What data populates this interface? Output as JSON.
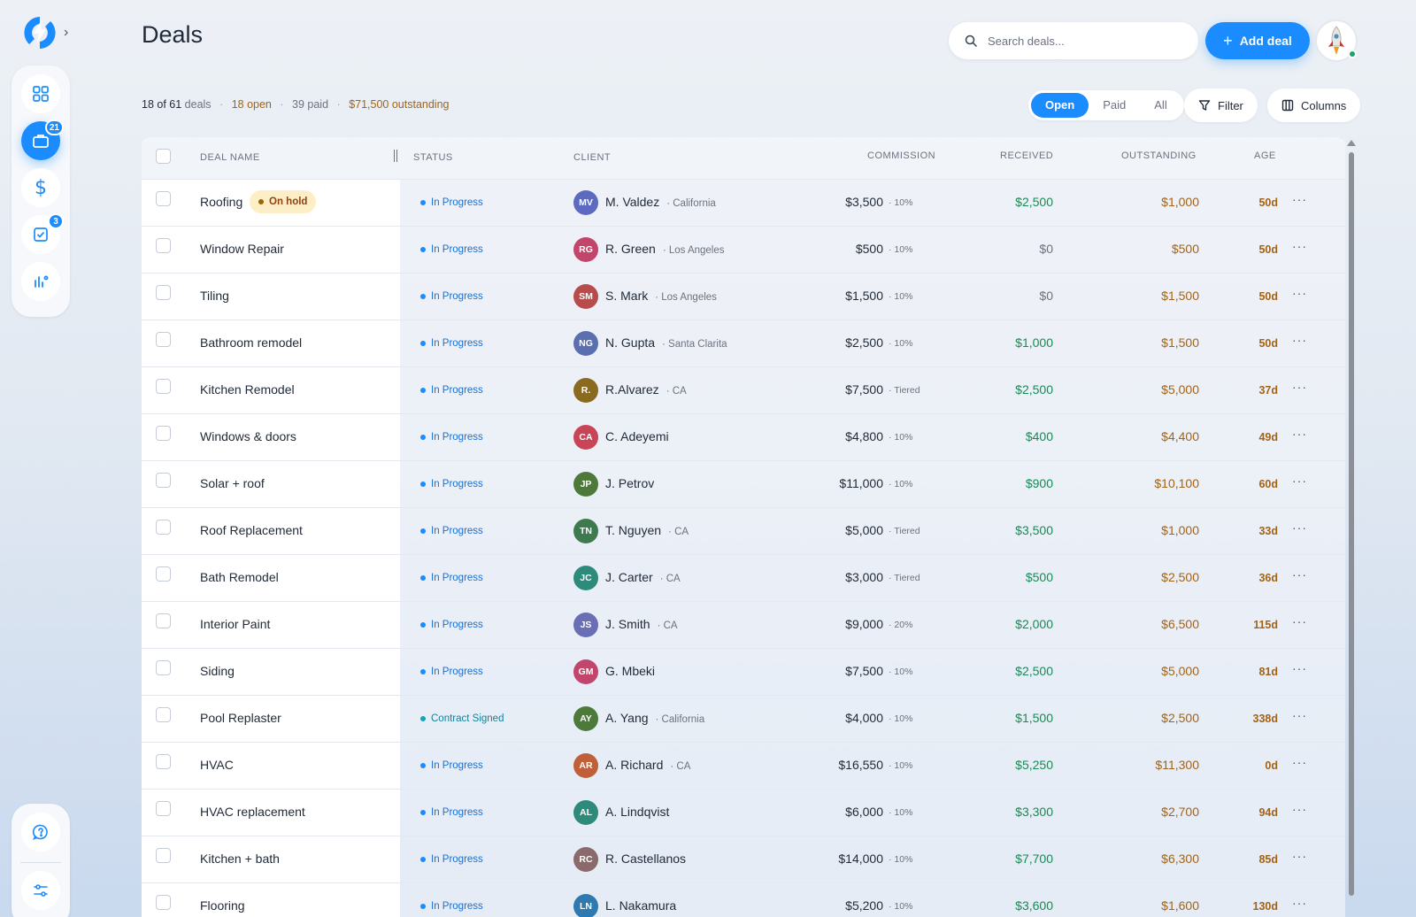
{
  "app": {
    "logo": "swap-logo-icon"
  },
  "header": {
    "title": "Deals",
    "search_placeholder": "Search deals...",
    "add_label": "Add deal"
  },
  "sidebar": {
    "items": [
      {
        "icon": "grid-icon",
        "badge": ""
      },
      {
        "icon": "briefcase-icon",
        "badge": "21"
      },
      {
        "icon": "dollar-icon",
        "badge": ""
      },
      {
        "icon": "checklist-icon",
        "badge": "3"
      },
      {
        "icon": "chart-icon",
        "badge": ""
      }
    ],
    "bottom": [
      {
        "icon": "help-chat-icon"
      },
      {
        "icon": "settings-sliders-icon"
      }
    ]
  },
  "summary": {
    "count": "18 of 61",
    "count_suffix": "deals",
    "open": "18 open",
    "paid": "39 paid",
    "outstanding": "$71,500 outstanding"
  },
  "filters": {
    "tabs": [
      "Open",
      "Paid",
      "All"
    ],
    "active": "Open",
    "filter_label": "Filter",
    "columns_label": "Columns"
  },
  "colors": {
    "accent": "#1a8cff",
    "received": "#178a55",
    "outstanding": "#a26316",
    "on_hold_bg": "#fcefc7"
  },
  "table": {
    "headers": {
      "deal_name": "DEAL NAME",
      "status": "STATUS",
      "client": "CLIENT",
      "commission": "COMMISSION",
      "received": "RECEIVED",
      "outstanding": "OUTSTANDING",
      "age": "AGE"
    },
    "rows": [
      {
        "name": "Roofing",
        "badge": "On hold",
        "status": "In Progress",
        "initials": "MV",
        "avatar": "#5c6bc0",
        "client": "M. Valdez",
        "loc": "· California",
        "commission": "$3,500",
        "rate": "· 10%",
        "received": "$2,500",
        "outstanding": "$1,000",
        "age": "50d"
      },
      {
        "name": "Window Repair",
        "badge": "",
        "status": "In Progress",
        "initials": "RG",
        "avatar": "#c2456b",
        "client": "R. Green",
        "loc": "· Los Angeles",
        "commission": "$500",
        "rate": "· 10%",
        "received": "$0",
        "outstanding": "$500",
        "age": "50d"
      },
      {
        "name": "Tiling",
        "badge": "",
        "status": "In Progress",
        "initials": "SM",
        "avatar": "#b84b4b",
        "client": "S. Mark",
        "loc": "· Los Angeles",
        "commission": "$1,500",
        "rate": "· 10%",
        "received": "$0",
        "outstanding": "$1,500",
        "age": "50d"
      },
      {
        "name": "Bathroom remodel",
        "badge": "",
        "status": "In Progress",
        "initials": "NG",
        "avatar": "#5b6fb0",
        "client": "N. Gupta",
        "loc": "· Santa Clarita",
        "commission": "$2,500",
        "rate": "· 10%",
        "received": "$1,000",
        "outstanding": "$1,500",
        "age": "50d"
      },
      {
        "name": "Kitchen Remodel",
        "badge": "",
        "status": "In Progress",
        "initials": "R.",
        "avatar": "#8a6a1e",
        "client": "R.Alvarez",
        "loc": "· CA",
        "commission": "$7,500",
        "rate": "· Tiered",
        "received": "$2,500",
        "outstanding": "$5,000",
        "age": "37d"
      },
      {
        "name": "Windows & doors",
        "badge": "",
        "status": "In Progress",
        "initials": "CA",
        "avatar": "#c94456",
        "client": "C. Adeyemi",
        "loc": "",
        "commission": "$4,800",
        "rate": "· 10%",
        "received": "$400",
        "outstanding": "$4,400",
        "age": "49d"
      },
      {
        "name": "Solar + roof",
        "badge": "",
        "status": "In Progress",
        "initials": "JP",
        "avatar": "#4d7a3a",
        "client": "J. Petrov",
        "loc": "",
        "commission": "$11,000",
        "rate": "· 10%",
        "received": "$900",
        "outstanding": "$10,100",
        "age": "60d"
      },
      {
        "name": "Roof Replacement",
        "badge": "",
        "status": "In Progress",
        "initials": "TN",
        "avatar": "#3f7a4f",
        "client": "T. Nguyen",
        "loc": "· CA",
        "commission": "$5,000",
        "rate": "· Tiered",
        "received": "$3,500",
        "outstanding": "$1,000",
        "age": "33d"
      },
      {
        "name": "Bath Remodel",
        "badge": "",
        "status": "In Progress",
        "initials": "JC",
        "avatar": "#2e8a7a",
        "client": "J. Carter",
        "loc": "· CA",
        "commission": "$3,000",
        "rate": "· Tiered",
        "received": "$500",
        "outstanding": "$2,500",
        "age": "36d"
      },
      {
        "name": "Interior Paint",
        "badge": "",
        "status": "In Progress",
        "initials": "JS",
        "avatar": "#6a6fb5",
        "client": "J. Smith",
        "loc": "· CA",
        "commission": "$9,000",
        "rate": "· 20%",
        "received": "$2,000",
        "outstanding": "$6,500",
        "age": "115d"
      },
      {
        "name": "Siding",
        "badge": "",
        "status": "In Progress",
        "initials": "GM",
        "avatar": "#c2456b",
        "client": "G. Mbeki",
        "loc": "",
        "commission": "$7,500",
        "rate": "· 10%",
        "received": "$2,500",
        "outstanding": "$5,000",
        "age": "81d"
      },
      {
        "name": "Pool Replaster",
        "badge": "",
        "status": "Contract Signed",
        "initials": "AY",
        "avatar": "#4d7a3a",
        "client": "A. Yang",
        "loc": "· California",
        "commission": "$4,000",
        "rate": "· 10%",
        "received": "$1,500",
        "outstanding": "$2,500",
        "age": "338d"
      },
      {
        "name": "HVAC",
        "badge": "",
        "status": "In Progress",
        "initials": "AR",
        "avatar": "#c0603a",
        "client": "A. Richard",
        "loc": "· CA",
        "commission": "$16,550",
        "rate": "· 10%",
        "received": "$5,250",
        "outstanding": "$11,300",
        "age": "0d"
      },
      {
        "name": "HVAC replacement",
        "badge": "",
        "status": "In Progress",
        "initials": "AL",
        "avatar": "#2e8a7a",
        "client": "A. Lindqvist",
        "loc": "",
        "commission": "$6,000",
        "rate": "· 10%",
        "received": "$3,300",
        "outstanding": "$2,700",
        "age": "94d"
      },
      {
        "name": "Kitchen + bath",
        "badge": "",
        "status": "In Progress",
        "initials": "RC",
        "avatar": "#8a6a6a",
        "client": "R. Castellanos",
        "loc": "",
        "commission": "$14,000",
        "rate": "· 10%",
        "received": "$7,700",
        "outstanding": "$6,300",
        "age": "85d"
      },
      {
        "name": "Flooring",
        "badge": "",
        "status": "In Progress",
        "initials": "LN",
        "avatar": "#2e7ab0",
        "client": "L. Nakamura",
        "loc": "",
        "commission": "$5,200",
        "rate": "· 10%",
        "received": "$3,600",
        "outstanding": "$1,600",
        "age": "130d"
      }
    ]
  }
}
